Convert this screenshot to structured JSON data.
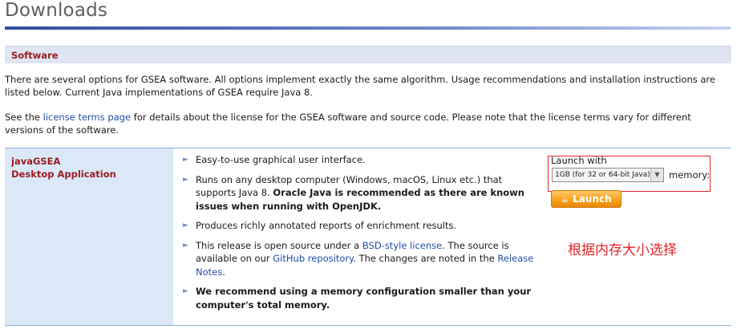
{
  "page": {
    "title": "Downloads"
  },
  "section": {
    "heading": "Software"
  },
  "intro": {
    "line1": "There are several options for GSEA software. All options implement exactly the same algorithm. Usage recommendations and installation instructions are listed below. Current Java implementations of GSEA require Java 8.",
    "license_prefix": "See the ",
    "license_link": "license terms page",
    "license_suffix": " for details about the license for the GSEA software and source code. Please note that the license terms vary for different versions of the software."
  },
  "app": {
    "name_line1": "javaGSEA",
    "name_line2": "Desktop Application",
    "features": [
      {
        "text": "Easy-to-use graphical user interface."
      },
      {
        "text_prefix": "Runs on any desktop computer (Windows, macOS, Linux etc.) that supports Java 8. ",
        "text_bold": "Oracle Java is recommended as there are known issues when running with OpenJDK."
      },
      {
        "text": "Produces richly annotated reports of enrichment results."
      },
      {
        "p1": "This release is open source under a ",
        "link1": "BSD-style license",
        "p2": ". The source is available on our ",
        "link2": "GitHub repository",
        "p3": ". The changes are noted in the ",
        "link3": "Release Notes",
        "p4": "."
      },
      {
        "text_bold": "We recommend using a memory configuration smaller than your computer's total memory."
      }
    ]
  },
  "launch": {
    "launch_with_label": "Launch with",
    "memory_selected": "1GB  (for 32 or 64-bit Java)",
    "memory_suffix": "memory:",
    "button_label": "Launch"
  },
  "annotation": {
    "text": "根据内存大小选择"
  },
  "colors": {
    "section_heading": "#9b1c1c",
    "link": "#1f4fa8",
    "launch_button": "#f7a21b",
    "annotation_red": "#e1262a"
  },
  "icons": {
    "bullet": "triangle-bullet-icon",
    "select_arrow": "chevron-down-icon",
    "launch": "java-cup-icon"
  }
}
